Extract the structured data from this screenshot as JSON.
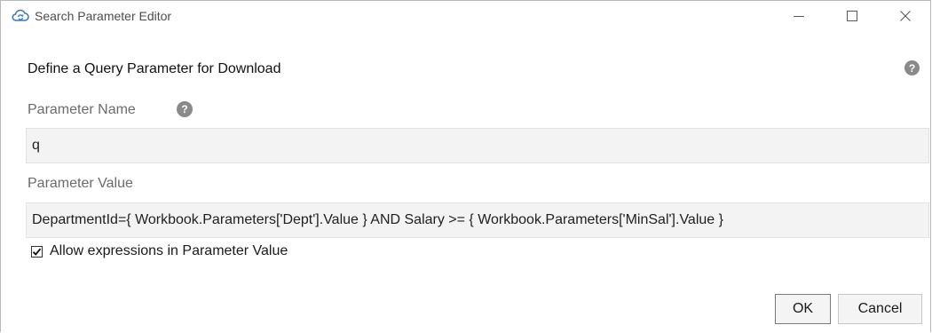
{
  "window": {
    "title": "Search Parameter Editor",
    "icon": "cloud-sync-icon"
  },
  "dialog": {
    "heading": "Define a Query Parameter for Download",
    "parameter_name_label": "Parameter Name",
    "parameter_name_value": "q",
    "parameter_value_label": "Parameter Value",
    "parameter_value_value": "DepartmentId={ Workbook.Parameters['Dept'].Value } AND Salary >= { Workbook.Parameters['MinSal'].Value }",
    "allow_expressions_label": "Allow expressions in Parameter Value",
    "allow_expressions_checked": true,
    "help_glyph": "?"
  },
  "buttons": {
    "ok": "OK",
    "cancel": "Cancel"
  },
  "colors": {
    "icon_blue": "#3b7bbf",
    "input_bg": "#f3f3f3",
    "help_bg": "#8a8a8a"
  }
}
